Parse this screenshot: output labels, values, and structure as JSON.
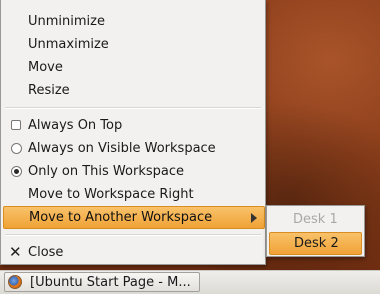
{
  "menu": {
    "items": [
      {
        "label": "Unminimize"
      },
      {
        "label": "Unmaximize"
      },
      {
        "label": "Move"
      },
      {
        "label": "Resize"
      },
      {
        "label": "Always On Top",
        "checked": false
      },
      {
        "label": "Always on Visible Workspace",
        "selected": false
      },
      {
        "label": "Only on This Workspace",
        "selected": true
      },
      {
        "label": "Move to Workspace Right"
      },
      {
        "label": "Move to Another Workspace",
        "highlighted": true
      },
      {
        "label": "Close"
      }
    ]
  },
  "submenu": {
    "items": [
      {
        "label": "Desk 1",
        "enabled": false
      },
      {
        "label": "Desk 2",
        "highlighted": true
      }
    ]
  },
  "taskbar": {
    "task_label": "[Ubuntu Start Page - M...",
    "task_icon": "firefox-icon"
  },
  "colors": {
    "highlight": "#f0a236",
    "menu_bg": "#f2f1f0",
    "desktop": "#8d3f1b"
  }
}
